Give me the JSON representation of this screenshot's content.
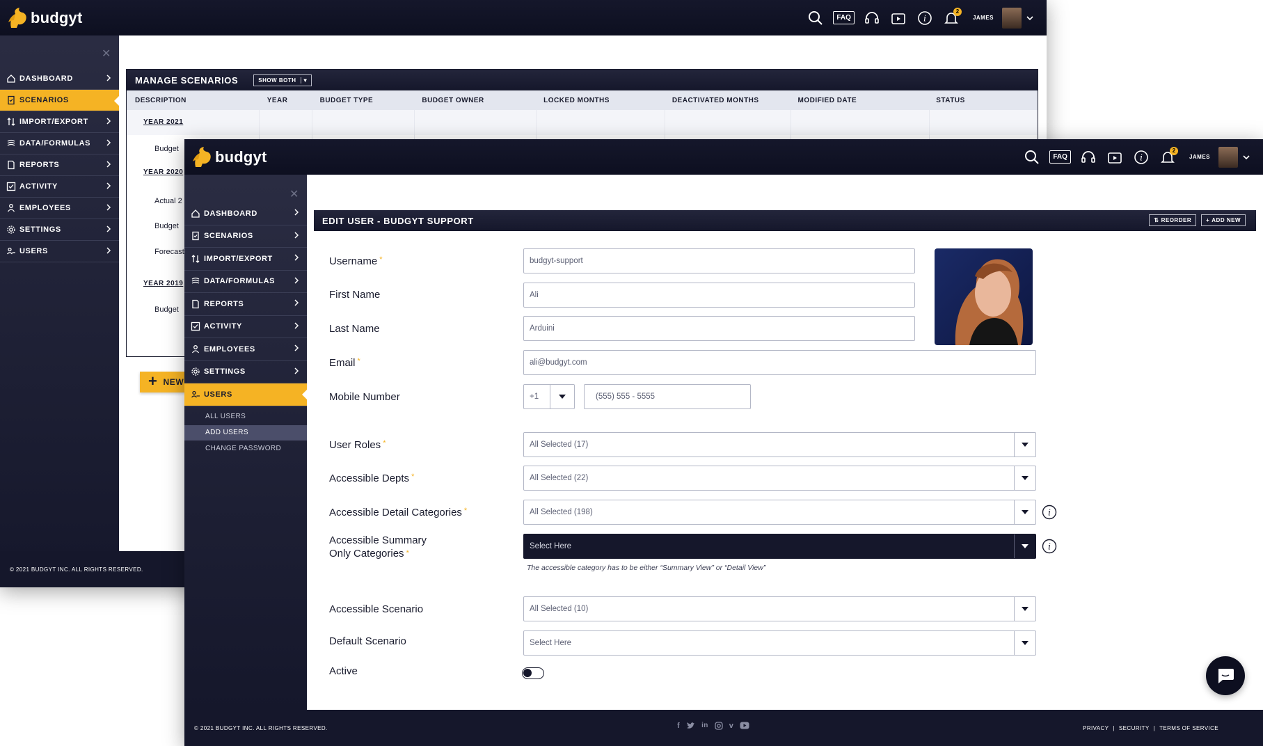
{
  "brand": {
    "name": "budgyt",
    "accent": "#f5b324",
    "dark": "#15172b"
  },
  "topbar": {
    "faq": "FAQ",
    "user_name": "JAMES",
    "notifications": "2",
    "icons": [
      "search-icon",
      "headset-icon",
      "video-icon",
      "info-icon",
      "bell-icon"
    ]
  },
  "back_window": {
    "sidebar": {
      "items": [
        {
          "label": "DASHBOARD",
          "icon": "home-icon"
        },
        {
          "label": "SCENARIOS",
          "icon": "scenario-icon",
          "active": true
        },
        {
          "label": "IMPORT/EXPORT",
          "icon": "import-export-icon"
        },
        {
          "label": "DATA/FORMULAS",
          "icon": "database-icon"
        },
        {
          "label": "REPORTS",
          "icon": "report-icon"
        },
        {
          "label": "ACTIVITY",
          "icon": "activity-icon"
        },
        {
          "label": "EMPLOYEES",
          "icon": "employees-icon"
        },
        {
          "label": "SETTINGS",
          "icon": "settings-icon"
        },
        {
          "label": "USERS",
          "icon": "users-icon"
        }
      ]
    },
    "panel": {
      "title": "MANAGE SCENARIOS",
      "filter_label": "SHOW BOTH",
      "columns": [
        "DESCRIPTION",
        "YEAR",
        "BUDGET TYPE",
        "BUDGET OWNER",
        "LOCKED MONTHS",
        "DEACTIVATED  MONTHS",
        "MODIFIED DATE",
        "STATUS"
      ],
      "rows": [
        {
          "text": "YEAR 2021",
          "type": "year"
        },
        {
          "text": "Budget",
          "type": "item"
        },
        {
          "text": "YEAR 2020",
          "type": "year"
        },
        {
          "text": "Actual 2",
          "type": "item"
        },
        {
          "text": "Budget",
          "type": "item"
        },
        {
          "text": "Forecast",
          "type": "item"
        },
        {
          "text": "YEAR 2019",
          "type": "year"
        },
        {
          "text": "Budget",
          "type": "item"
        }
      ],
      "new_button": "NEW"
    },
    "footer": {
      "copyright": "© 2021 BUDGYT INC. ALL RIGHTS RESERVED."
    }
  },
  "front_window": {
    "sidebar": {
      "items": [
        {
          "label": "DASHBOARD",
          "icon": "home-icon"
        },
        {
          "label": "SCENARIOS",
          "icon": "scenario-icon"
        },
        {
          "label": "IMPORT/EXPORT",
          "icon": "import-export-icon"
        },
        {
          "label": "DATA/FORMULAS",
          "icon": "database-icon"
        },
        {
          "label": "REPORTS",
          "icon": "report-icon"
        },
        {
          "label": "ACTIVITY",
          "icon": "activity-icon"
        },
        {
          "label": "EMPLOYEES",
          "icon": "employees-icon"
        },
        {
          "label": "SETTINGS",
          "icon": "settings-icon"
        },
        {
          "label": "USERS",
          "icon": "users-icon",
          "active": true
        }
      ],
      "subitems": [
        {
          "label": "ALL USERS"
        },
        {
          "label": "ADD USERS",
          "active": true
        },
        {
          "label": "CHANGE PASSWORD"
        }
      ]
    },
    "panel": {
      "title": "EDIT USER - BUDGYT SUPPORT",
      "reorder": "REORDER",
      "add_new": "ADD NEW"
    },
    "form": {
      "username": {
        "label": "Username",
        "value": "budgyt-support",
        "required": true
      },
      "first_name": {
        "label": "First Name",
        "value": "Ali"
      },
      "last_name": {
        "label": "Last Name",
        "value": "Arduini"
      },
      "email": {
        "label": "Email",
        "value": "ali@budgyt.com",
        "required": true
      },
      "mobile": {
        "label": "Mobile Number",
        "country_code": "+1",
        "placeholder": "(555) 555 - 5555"
      },
      "user_roles": {
        "label": "User Roles",
        "value": "All Selected (17)",
        "required": true
      },
      "depts": {
        "label": "Accessible Depts",
        "value": "All Selected (22)",
        "required": true
      },
      "detail_categories": {
        "label": "Accessible Detail Categories",
        "value": "All Selected (198)",
        "required": true
      },
      "summary_categories": {
        "label_line1": "Accessible Summary",
        "label_line2": "Only Categories",
        "value": "Select Here",
        "required": true
      },
      "category_hint": "The accessible category has to be either “Summary View” or “Detail View”",
      "scenario": {
        "label": "Accessible Scenario",
        "value": "All Selected (10)"
      },
      "default_scenario": {
        "label": "Default Scenario",
        "value": "Select Here"
      },
      "active": {
        "label": "Active",
        "on": false
      }
    },
    "footer": {
      "copyright": "© 2021 BUDGYT INC. ALL RIGHTS RESERVED.",
      "social": [
        "facebook-icon",
        "twitter-icon",
        "linkedin-icon",
        "instagram-icon",
        "vimeo-icon",
        "youtube-icon"
      ],
      "links": [
        "PRIVACY",
        "SECURITY",
        "TERMS OF SERVICE"
      ]
    }
  }
}
